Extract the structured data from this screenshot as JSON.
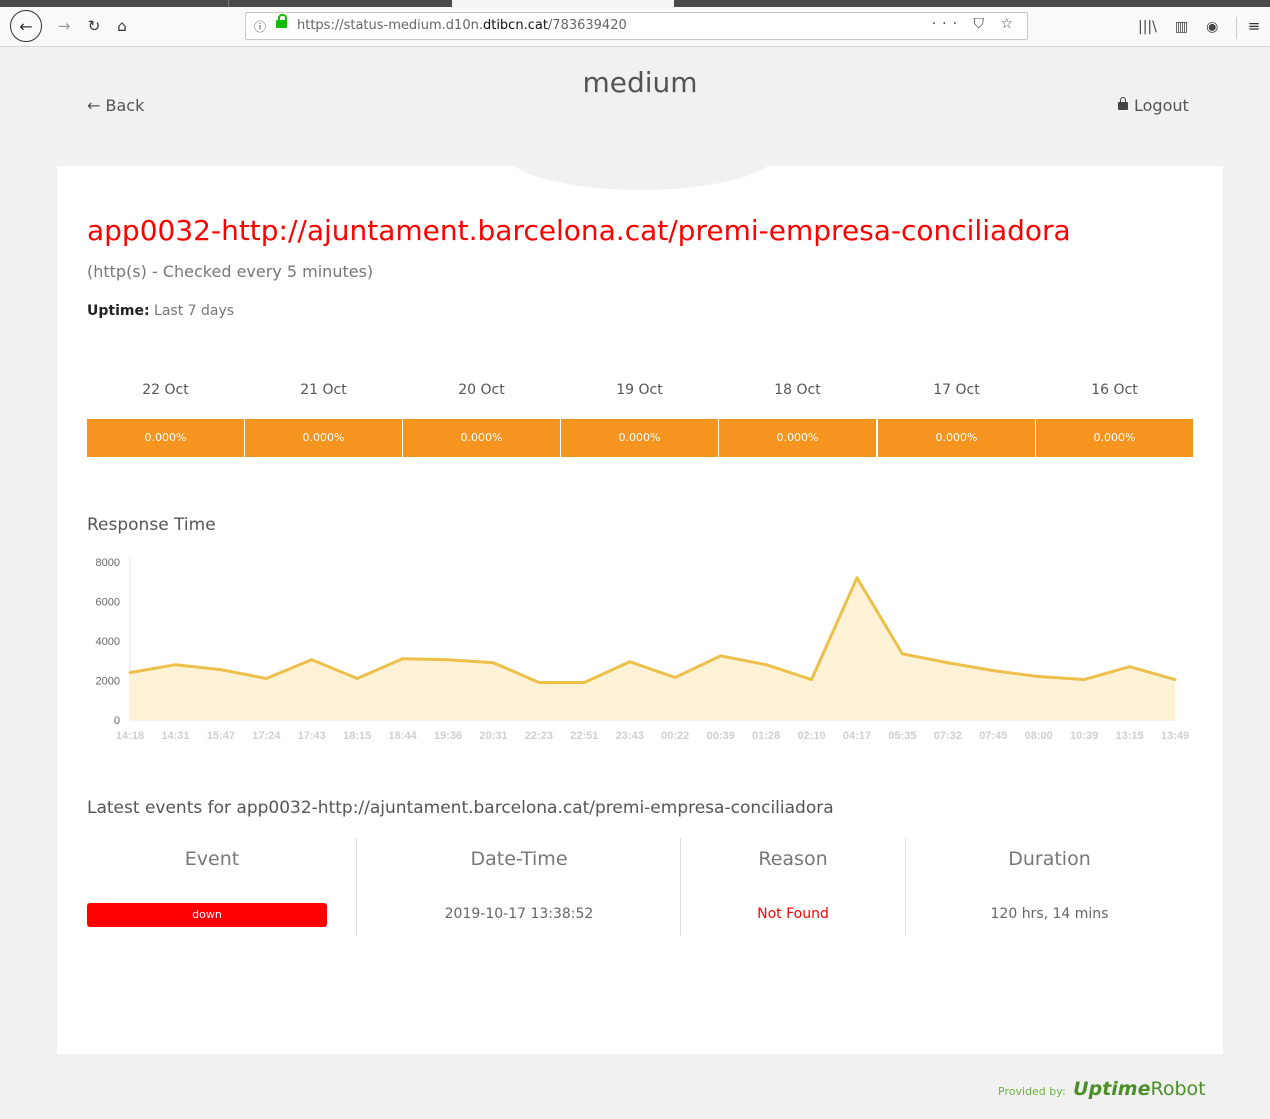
{
  "browser": {
    "url_prefix": "https://status-medium.d10n.",
    "url_domain": "dtibcn.cat",
    "url_path": "/783639420",
    "page_actions": "··· ⛉ ☆"
  },
  "header": {
    "title": "medium",
    "back_label": "← Back",
    "logout_label": "Logout"
  },
  "monitor": {
    "title": "app0032-http://ajuntament.barcelona.cat/premi-empresa-conciliadora",
    "subtitle": "(http(s) - Checked every 5 minutes)",
    "uptime_label": "Uptime:",
    "uptime_range": "Last 7 days"
  },
  "uptime_days": [
    {
      "date": "22 Oct",
      "pct": "0.000%"
    },
    {
      "date": "21 Oct",
      "pct": "0.000%"
    },
    {
      "date": "20 Oct",
      "pct": "0.000%"
    },
    {
      "date": "19 Oct",
      "pct": "0.000%"
    },
    {
      "date": "18 Oct",
      "pct": "0.000%"
    },
    {
      "date": "17 Oct",
      "pct": "0.000%"
    },
    {
      "date": "16 Oct",
      "pct": "0.000%"
    }
  ],
  "response_time": {
    "title": "Response Time"
  },
  "chart_data": {
    "type": "area",
    "x": [
      "14:18",
      "14:31",
      "15:47",
      "17:24",
      "17:43",
      "18:15",
      "18:44",
      "19:36",
      "20:31",
      "22:23",
      "22:51",
      "23:43",
      "00:22",
      "00:39",
      "01:28",
      "02:10",
      "04:17",
      "05:35",
      "07:32",
      "07:45",
      "08:00",
      "10:39",
      "13:15",
      "13:49"
    ],
    "series": [
      {
        "values": [
          2400,
          2800,
          2550,
          2100,
          3050,
          2100,
          3100,
          3050,
          2900,
          1900,
          1900,
          2950,
          2150,
          3250,
          2800,
          2050,
          7200,
          3350,
          2900,
          2500,
          2200,
          2050,
          2700,
          2050
        ]
      }
    ],
    "ylim": [
      0,
      8000
    ],
    "yticks": [
      "0",
      "2000",
      "4000",
      "6000",
      "8000"
    ],
    "colors": {
      "line": "#ecc04a",
      "fill": "#fdf2d6"
    }
  },
  "events": {
    "title": "Latest events for app0032-http://ajuntament.barcelona.cat/premi-empresa-conciliadora",
    "headers": [
      "Event",
      "Date-Time",
      "Reason",
      "Duration"
    ],
    "rows": [
      {
        "event": "down",
        "datetime": "2019-10-17 13:38:52",
        "reason": "Not Found",
        "duration": "120 hrs, 14 mins"
      }
    ]
  },
  "footer": {
    "provided_by": "Provided by:",
    "brand_bold": "Uptime",
    "brand_rest": "Robot"
  },
  "colors": {
    "accent": "#ff0000",
    "uptime_bar": "#f69420",
    "brand": "#4b8f29"
  }
}
